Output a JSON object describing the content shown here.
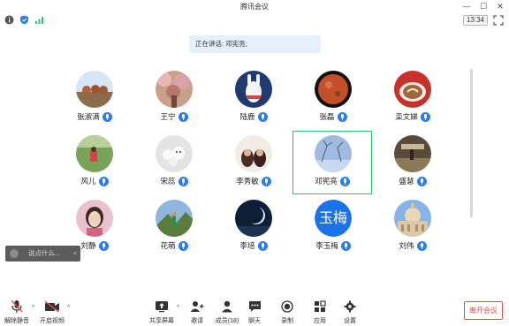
{
  "window": {
    "title": "腾讯会议",
    "minimize": "—",
    "maximize": "☐",
    "close": "✕"
  },
  "status": {
    "time": "13:34"
  },
  "speaking": {
    "prefix": "正在讲话:",
    "name": "邓宪亮;"
  },
  "participants": [
    {
      "name": "张淑满",
      "mic": true
    },
    {
      "name": "王宁",
      "mic": true
    },
    {
      "name": "陆鹿",
      "mic": true
    },
    {
      "name": "张磊",
      "mic": true
    },
    {
      "name": "栾文娣",
      "mic": true
    },
    {
      "name": "风儿",
      "mic": true
    },
    {
      "name": "宋蕊",
      "mic": true
    },
    {
      "name": "李秀敏",
      "mic": true
    },
    {
      "name": "邓宪亮",
      "mic": true,
      "active": true
    },
    {
      "name": "盛慧",
      "mic": true
    },
    {
      "name": "刘静",
      "mic": true
    },
    {
      "name": "花萌",
      "mic": true
    },
    {
      "name": "李培",
      "mic": true
    },
    {
      "name": "李玉梅",
      "mic": true,
      "avatar_text": "玉梅"
    },
    {
      "name": "刘伟",
      "mic": true
    }
  ],
  "chat": {
    "placeholder": "说点什么...",
    "collapse": "<"
  },
  "toolbar": {
    "unmute": "解除静音",
    "start_video": "开启视频",
    "share_screen": "共享屏幕",
    "invite": "邀请",
    "members": "成员(18)",
    "chat": "聊天",
    "record": "录制",
    "apps": "应用",
    "settings": "设置",
    "caret": "^",
    "leave": "离开会议"
  },
  "colors": {
    "accent": "#2b7de9",
    "active_border": "#2ec26a",
    "leave": "#e24e4e"
  }
}
